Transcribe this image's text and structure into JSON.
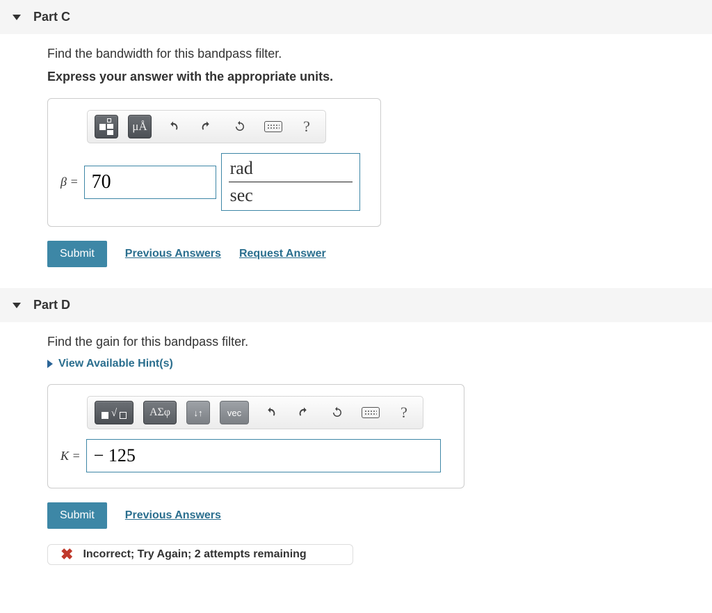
{
  "partC": {
    "title": "Part C",
    "prompt": "Find the bandwidth for this bandpass filter.",
    "instruction": "Express your answer with the appropriate units.",
    "toolbar": {
      "units_label": "μÅ",
      "help_label": "?"
    },
    "variable": "β =",
    "value": "70",
    "unit_numerator": "rad",
    "unit_denominator": "sec",
    "submit_label": "Submit",
    "previous_answers_label": "Previous Answers",
    "request_answer_label": "Request Answer"
  },
  "partD": {
    "title": "Part D",
    "prompt": "Find the gain for this bandpass filter.",
    "hints_label": "View Available Hint(s)",
    "toolbar": {
      "greek_label": "ΑΣφ",
      "swap_label": "↓↑",
      "vec_label": "vec",
      "help_label": "?"
    },
    "variable": "K =",
    "value": "− 125",
    "submit_label": "Submit",
    "previous_answers_label": "Previous Answers",
    "feedback_text": "Incorrect; Try Again; 2 attempts remaining"
  }
}
